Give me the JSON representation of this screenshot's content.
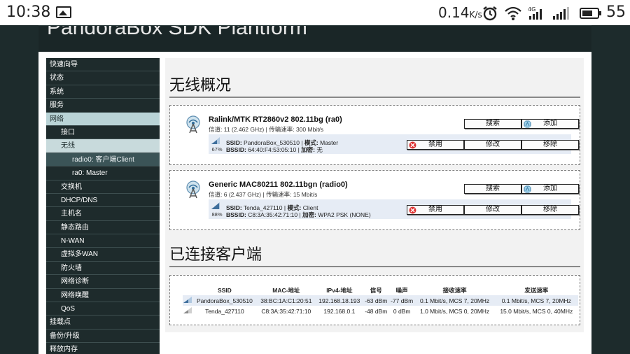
{
  "statusbar": {
    "time": "10:38",
    "speed": "0.14",
    "speed_unit": "K/s",
    "battery": "55"
  },
  "header": {
    "brand": "PandoraBox SDK Plantform"
  },
  "sidebar": {
    "items": [
      "快速向导",
      "状态",
      "系统",
      "服务",
      "网络",
      "接口",
      "无线",
      "radio0: 客户端Client",
      "ra0: Master",
      "交换机",
      "DHCP/DNS",
      "主机名",
      "静态路由",
      "N-WAN",
      "虚拟多WAN",
      "防火墙",
      "网络诊断",
      "网络唤醒",
      "QoS",
      "挂载点",
      "备份/升级",
      "释放内存"
    ]
  },
  "main": {
    "wireless_title": "无线概况",
    "clients_title": "已连接客户端",
    "devices": [
      {
        "title": "Ralink/MTK RT2860v2 802.11bg (ra0)",
        "channel_label": "信道:",
        "channel": "11 (2.462 GHz)",
        "rate_label": "传输速率:",
        "rate": "300 Mbit/s",
        "signal_pct": "67%",
        "ssid_label": "SSID:",
        "ssid": "PandoraBox_530510",
        "mode_label": "模式:",
        "mode": "Master",
        "bssid_label": "BSSID:",
        "bssid": "64:40:F4:53:05:10",
        "enc_label": "加密:",
        "enc": "无"
      },
      {
        "title": "Generic MAC80211 802.11bgn (radio0)",
        "channel_label": "信道:",
        "channel": "6 (2.437 GHz)",
        "rate_label": "传输速率:",
        "rate": "15 Mbit/s",
        "signal_pct": "88%",
        "ssid_label": "SSID:",
        "ssid": "Tenda_427110",
        "mode_label": "模式:",
        "mode": "Client",
        "bssid_label": "BSSID:",
        "bssid": "C8:3A:35:42:71:10",
        "enc_label": "加密:",
        "enc": "WPA2 PSK (NONE)"
      }
    ],
    "buttons": {
      "scan": "搜索",
      "add": "添加",
      "disable": "禁用",
      "edit": "修改",
      "remove": "移除"
    },
    "table": {
      "headers": [
        "SSID",
        "MAC-地址",
        "IPv4-地址",
        "信号",
        "噪声",
        "接收速率",
        "发送速率"
      ],
      "rows": [
        [
          "PandoraBox_530510",
          "38:BC:1A:C1:20:51",
          "192.168.18.193",
          "-63 dBm",
          "-77 dBm",
          "0.1 Mbit/s, MCS 7, 20MHz",
          "0.1 Mbit/s, MCS 7, 20MHz"
        ],
        [
          "Tenda_427110",
          "C8:3A:35:42:71:10",
          "192.168.0.1",
          "-48 dBm",
          "0 dBm",
          "1.0 Mbit/s, MCS 0, 20MHz",
          "15.0 Mbit/s, MCS 0, 40MHz"
        ]
      ]
    }
  },
  "colors": {
    "sidebar_bg": "#1e2b2c",
    "active_item": "#b9d3d6",
    "row_highlight": "#e6ecf5"
  },
  "icons": [
    "image-icon",
    "alarm-clock-icon",
    "wifi-icon",
    "cell-signal-icon",
    "battery-icon",
    "antenna-icon",
    "signal-strength-icon",
    "disable-icon",
    "add-icon"
  ]
}
